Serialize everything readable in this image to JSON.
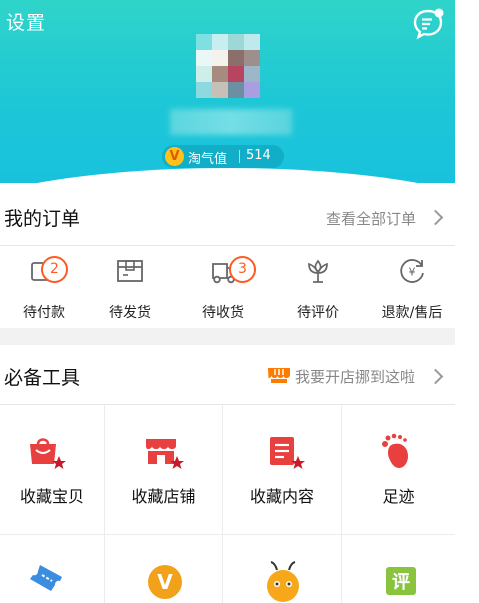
{
  "header": {
    "settings_label": "设置",
    "taoqi": {
      "label": "淘气值",
      "value": "514",
      "icon_letter": "V"
    }
  },
  "orders": {
    "title": "我的订单",
    "view_all": "查看全部订单",
    "items": [
      {
        "label": "待付款",
        "icon": "wallet-icon",
        "badge": "2"
      },
      {
        "label": "待发货",
        "icon": "package-icon"
      },
      {
        "label": "待收货",
        "icon": "truck-icon",
        "badge": "3"
      },
      {
        "label": "待评价",
        "icon": "flower-icon"
      },
      {
        "label": "退款/售后",
        "icon": "refund-icon"
      }
    ]
  },
  "tools": {
    "title": "必备工具",
    "promo_text": "我要开店挪到这啦",
    "items": [
      {
        "label": "收藏宝贝",
        "icon": "favorite-bag-icon"
      },
      {
        "label": "收藏店铺",
        "icon": "favorite-shop-icon"
      },
      {
        "label": "收藏内容",
        "icon": "favorite-content-icon"
      },
      {
        "label": "足迹",
        "icon": "footprint-icon"
      },
      {
        "label": "",
        "icon": "ticket-icon"
      },
      {
        "label": "",
        "icon": "v-badge-icon"
      },
      {
        "label": "",
        "icon": "bee-icon"
      },
      {
        "label": "",
        "icon": "review-icon"
      }
    ],
    "review_icon_text": "评",
    "v_icon_letter": "V"
  },
  "colors": {
    "header_start": "#2fd4c9",
    "header_end": "#18c2dd",
    "badge": "#ff5a1f",
    "tool_red": "#e8403f",
    "promo_orange": "#ff7a00"
  }
}
